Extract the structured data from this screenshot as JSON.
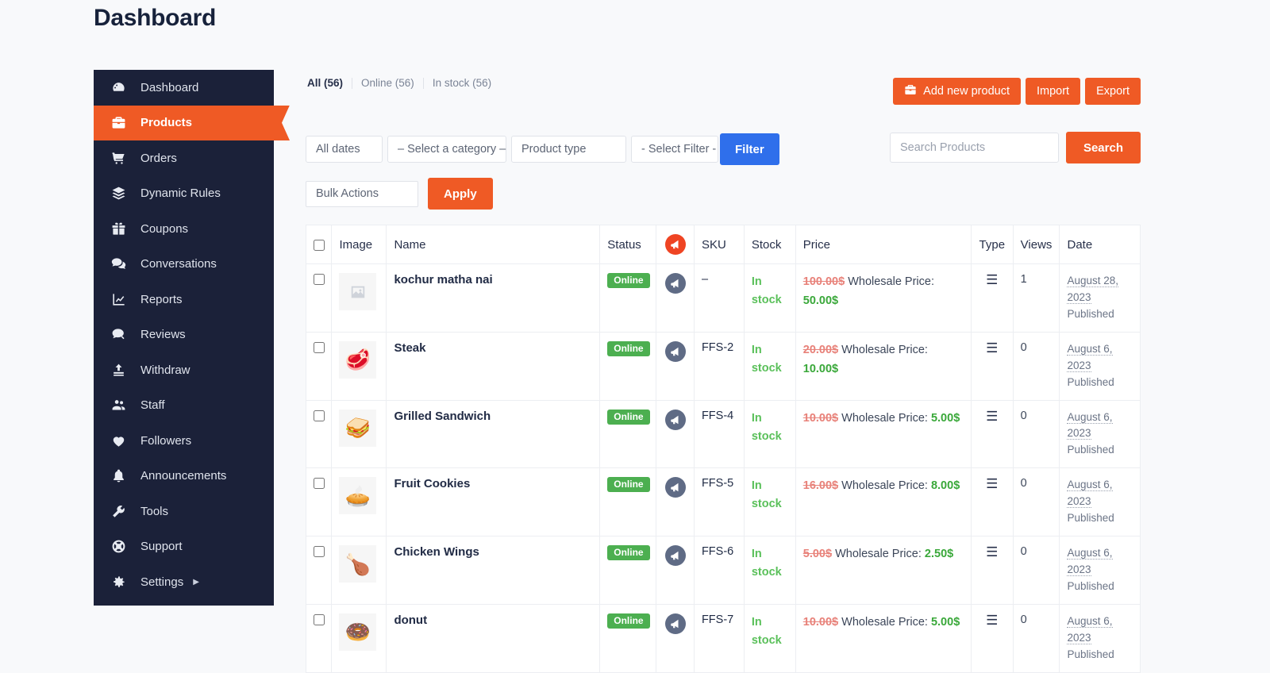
{
  "page": {
    "title": "Dashboard"
  },
  "theme": {
    "accent_orange": "#ef5a25",
    "sidebar_navy": "#1b2139",
    "filter_blue": "#2f6feb",
    "status_green": "#4caf50",
    "page_bg": "#f8f9fb"
  },
  "sidebar": {
    "items": [
      {
        "label": "Dashboard",
        "icon": "speedometer-icon",
        "active": false
      },
      {
        "label": "Products",
        "icon": "briefcase-icon",
        "active": true
      },
      {
        "label": "Orders",
        "icon": "cart-icon",
        "active": false
      },
      {
        "label": "Dynamic Rules",
        "icon": "layers-icon",
        "active": false
      },
      {
        "label": "Coupons",
        "icon": "gift-icon",
        "active": false
      },
      {
        "label": "Conversations",
        "icon": "chat-icon",
        "active": false
      },
      {
        "label": "Reports",
        "icon": "chart-line-icon",
        "active": false
      },
      {
        "label": "Reviews",
        "icon": "review-icon",
        "active": false
      },
      {
        "label": "Withdraw",
        "icon": "upload-icon",
        "active": false
      },
      {
        "label": "Staff",
        "icon": "users-icon",
        "active": false
      },
      {
        "label": "Followers",
        "icon": "heart-icon",
        "active": false
      },
      {
        "label": "Announcements",
        "icon": "bell-icon",
        "active": false
      },
      {
        "label": "Tools",
        "icon": "wrench-icon",
        "active": false
      },
      {
        "label": "Support",
        "icon": "lifebuoy-icon",
        "active": false
      },
      {
        "label": "Settings",
        "icon": "gear-icon",
        "active": false,
        "caret": "▶"
      }
    ]
  },
  "status_tabs": [
    {
      "label": "All (56)"
    },
    {
      "label": "Online (56)"
    },
    {
      "label": "In stock (56)"
    }
  ],
  "top_actions": {
    "add_product": "Add new product",
    "import": "Import",
    "export": "Export"
  },
  "filters": {
    "dates": "All dates",
    "category": "– Select a category –",
    "product_type": "Product type",
    "select_filter": "- Select Filter -",
    "filter_button": "Filter"
  },
  "search": {
    "placeholder": "Search Products",
    "value": "",
    "button": "Search"
  },
  "bulk": {
    "select_value": "Bulk Actions",
    "apply_button": "Apply"
  },
  "table": {
    "headers": {
      "image": "Image",
      "name": "Name",
      "status": "Status",
      "promo": "megaphone-icon",
      "sku": "SKU",
      "stock": "Stock",
      "price": "Price",
      "type": "Type",
      "views": "Views",
      "date": "Date"
    },
    "price_label": "Wholesale Price:",
    "rows": [
      {
        "name": "kochur matha nai",
        "image": "placeholder",
        "status": "Online",
        "sku": "–",
        "stock": "In stock",
        "price_old": "100.00$",
        "price_new": "50.00$",
        "views": "1",
        "date": "August 28, 2023",
        "date_status": "Published"
      },
      {
        "name": "Steak",
        "image": "🥩",
        "status": "Online",
        "sku": "FFS-2",
        "stock": "In stock",
        "price_old": "20.00$",
        "price_new": "10.00$",
        "views": "0",
        "date": "August 6, 2023",
        "date_status": "Published"
      },
      {
        "name": "Grilled Sandwich",
        "image": "🥪",
        "status": "Online",
        "sku": "FFS-4",
        "stock": "In stock",
        "price_old": "10.00$",
        "price_new": "5.00$",
        "views": "0",
        "date": "August 6, 2023",
        "date_status": "Published"
      },
      {
        "name": "Fruit Cookies",
        "image": "🥧",
        "status": "Online",
        "sku": "FFS-5",
        "stock": "In stock",
        "price_old": "16.00$",
        "price_new": "8.00$",
        "views": "0",
        "date": "August 6, 2023",
        "date_status": "Published"
      },
      {
        "name": "Chicken Wings",
        "image": "🍗",
        "status": "Online",
        "sku": "FFS-6",
        "stock": "In stock",
        "price_old": "5.00$",
        "price_new": "2.50$",
        "views": "0",
        "date": "August 6, 2023",
        "date_status": "Published"
      },
      {
        "name": "donut",
        "image": "🍩",
        "status": "Online",
        "sku": "FFS-7",
        "stock": "In stock",
        "price_old": "10.00$",
        "price_new": "5.00$",
        "views": "0",
        "date": "August 6, 2023",
        "date_status": "Published"
      }
    ]
  }
}
